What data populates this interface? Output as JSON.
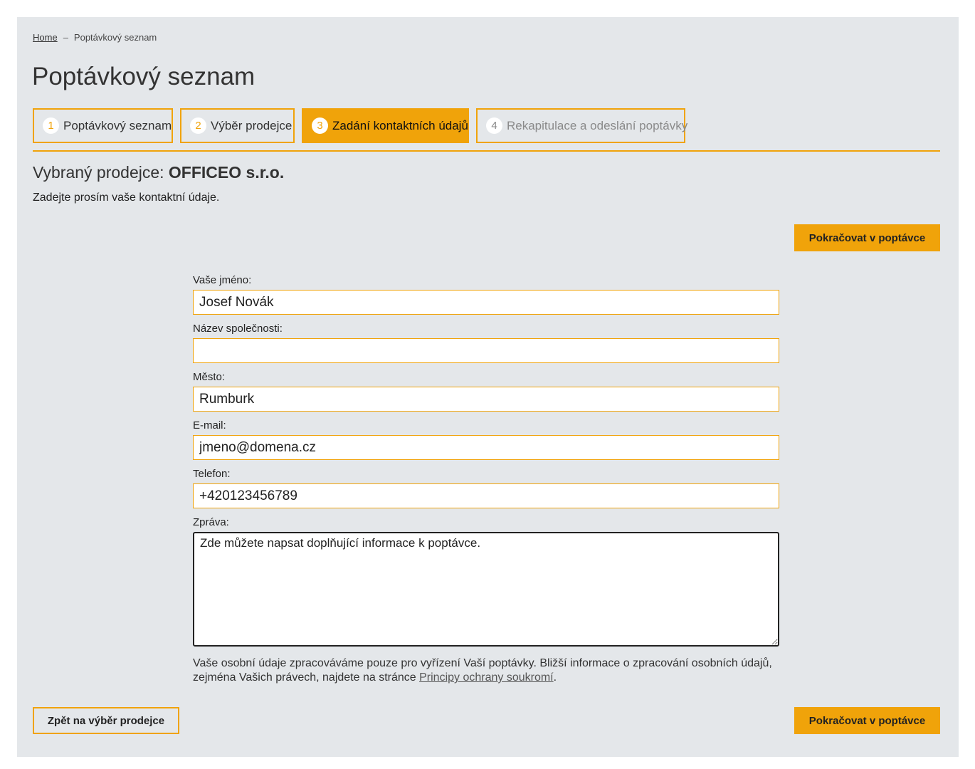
{
  "breadcrumb": {
    "home": "Home",
    "separator": "–",
    "current": "Poptávkový seznam"
  },
  "page": {
    "title": "Poptávkový seznam"
  },
  "steps": [
    {
      "number": "1",
      "label": "Poptávkový seznam"
    },
    {
      "number": "2",
      "label": "Výběr prodejce"
    },
    {
      "number": "3",
      "label": "Zadání kontaktních údajů"
    },
    {
      "number": "4",
      "label": "Rekapitulace a odeslání poptávky"
    }
  ],
  "vendor": {
    "prefix": "Vybraný prodejce:",
    "name": "OFFICEO s.r.o."
  },
  "instructions": "Zadejte prosím vaše kontaktní údaje.",
  "buttons": {
    "continue": "Pokračovat v poptávce",
    "back": "Zpět na výběr prodejce"
  },
  "form": {
    "name": {
      "label": "Vaše jméno:",
      "value": "Josef Novák"
    },
    "company": {
      "label": "Název společnosti:",
      "value": ""
    },
    "city": {
      "label": "Město:",
      "value": "Rumburk"
    },
    "email": {
      "label": "E-mail:",
      "value": "jmeno@domena.cz"
    },
    "phone": {
      "label": "Telefon:",
      "value": "+420123456789"
    },
    "message": {
      "label": "Zpráva:",
      "value": "Zde můžete napsat doplňující informace k poptávce."
    }
  },
  "privacy": {
    "text": "Vaše osobní údaje zpracováváme pouze pro vyřízení Vaší poptávky. Bližší informace o zpracování osobních údajů, zejména Vašich právech, najdete na stránce ",
    "link": "Principy ochrany soukromí",
    "suffix": "."
  },
  "colors": {
    "accent": "#f0a30a",
    "panel_bg": "#e4e7ea"
  }
}
